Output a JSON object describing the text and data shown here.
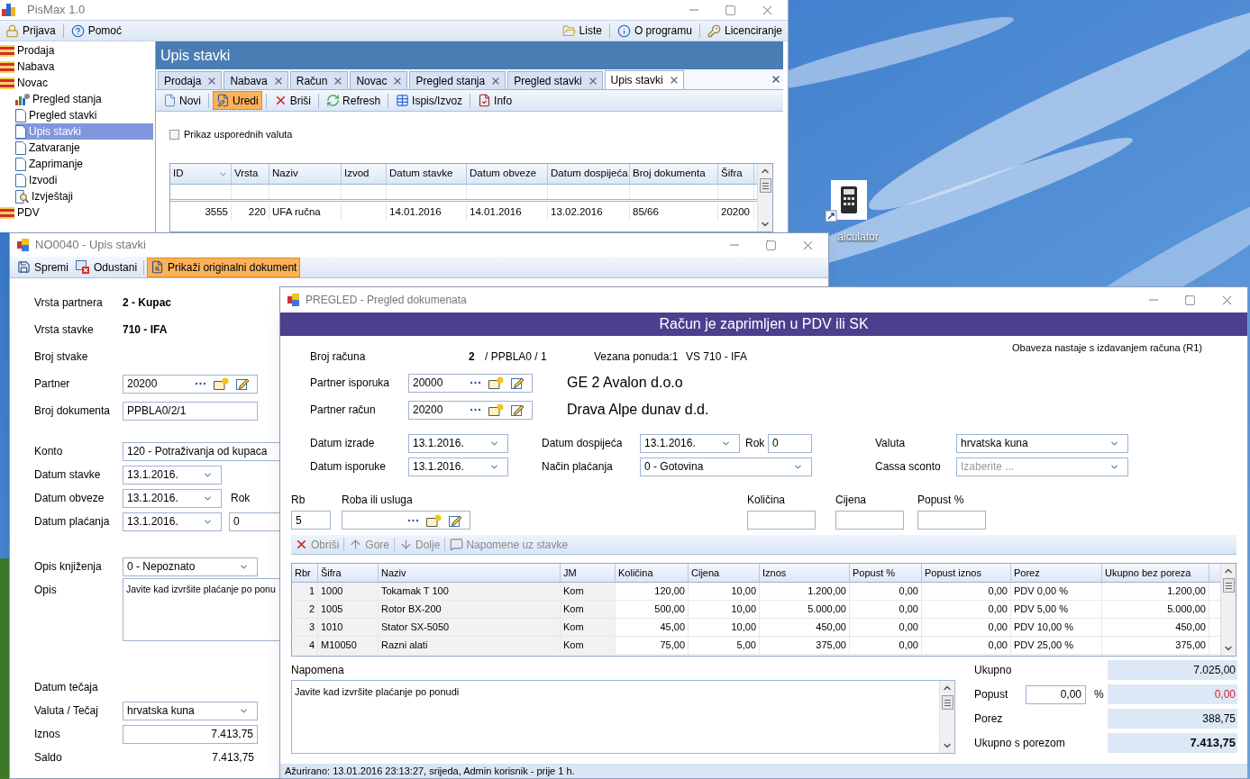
{
  "desktop": {
    "icons": [
      {
        "label": "alculator"
      }
    ]
  },
  "main_window": {
    "title": "PisMax 1.0",
    "menu_left": [
      {
        "label": "Prijava",
        "kind": "lock"
      },
      {
        "label": "Pomoć",
        "kind": "help"
      }
    ],
    "menu_right": [
      {
        "label": "Liste",
        "kind": "folder"
      },
      {
        "label": "O programu",
        "kind": "info"
      },
      {
        "label": "Licenciranje",
        "kind": "key"
      }
    ],
    "tree": [
      {
        "label": "Prodaja",
        "kind": "module",
        "selected": false
      },
      {
        "label": "Nabava",
        "kind": "module",
        "selected": false
      },
      {
        "label": "Novac",
        "kind": "module",
        "selected": false,
        "children": [
          {
            "label": "Pregled stanja",
            "kind": "chart",
            "selected": false
          },
          {
            "label": "Pregled stavki",
            "kind": "page",
            "selected": false
          },
          {
            "label": "Upis stavki",
            "kind": "page",
            "selected": true
          },
          {
            "label": "Zatvaranje",
            "kind": "page",
            "selected": false
          },
          {
            "label": "Zaprimanje",
            "kind": "page",
            "selected": false
          },
          {
            "label": "Izvodi",
            "kind": "page",
            "selected": false
          },
          {
            "label": "Izvještaji",
            "kind": "report",
            "selected": false
          }
        ]
      },
      {
        "label": "PDV",
        "kind": "module",
        "selected": false
      }
    ],
    "panel_title": "Upis stavki",
    "tabs": [
      {
        "label": "Prodaja",
        "selected": false
      },
      {
        "label": "Nabava",
        "selected": false
      },
      {
        "label": "Račun",
        "selected": false
      },
      {
        "label": "Novac",
        "selected": false
      },
      {
        "label": "Pregled stanja",
        "selected": false
      },
      {
        "label": "Pregled stavki",
        "selected": false
      },
      {
        "label": "Upis stavki",
        "selected": true
      }
    ],
    "toolbar": [
      {
        "label": "Novi",
        "kind": "new",
        "selected": false
      },
      {
        "label": "Uredi",
        "kind": "edit",
        "selected": true
      },
      {
        "label": "Briši",
        "kind": "delete",
        "selected": false
      },
      {
        "label": "Refresh",
        "kind": "refresh",
        "selected": false
      },
      {
        "label": "Ispis/Izvoz",
        "kind": "table",
        "selected": false
      },
      {
        "label": "Info",
        "kind": "info",
        "selected": false
      }
    ],
    "checkbox": {
      "label": "Prikaz usporednih valuta",
      "checked": false
    },
    "grid": {
      "columns": [
        "ID",
        "Vrsta",
        "Naziv",
        "Izvod",
        "Datum stavke",
        "Datum obveze",
        "Datum dospijeća",
        "Broj dokumenta",
        "Šifra"
      ],
      "rows": [
        {
          "cells": [
            "3555",
            "220",
            "UFA ručna",
            null,
            "14.01.2016",
            "14.01.2016",
            "13.02.2016",
            "85/66",
            "20200"
          ]
        }
      ]
    }
  },
  "entry_window": {
    "title": "NO0040 - Upis stavki",
    "toolbar": [
      {
        "label": "Spremi",
        "kind": "save",
        "selected": false
      },
      {
        "label": "Odustani",
        "kind": "cancel",
        "selected": false
      },
      {
        "label": "Prikaži originalni dokument",
        "kind": "document",
        "selected": true
      }
    ],
    "groups": [
      [
        {
          "label": "Vrsta partnera",
          "kind": "static",
          "value": "2 - Kupac"
        },
        {
          "label": "Vrsta stavke",
          "kind": "static",
          "value": "710 - IFA"
        },
        {
          "label": "Broj stvake",
          "kind": "label"
        },
        {
          "label": "Partner",
          "kind": "lookup",
          "value": "20200"
        },
        {
          "label": "Broj dokumenta",
          "kind": "text",
          "value": "PPBLA0/2/1"
        }
      ],
      [
        {
          "label": "Konto",
          "kind": "wide",
          "value": "120 - Potraživanja od kupaca"
        },
        {
          "label": "Datum stavke",
          "kind": "date",
          "value": "13.1.2016."
        },
        {
          "label": "Datum obveze",
          "kind": "date",
          "value": "13.1.2016.",
          "extra": {
            "kind": "label",
            "text": "Rok"
          }
        },
        {
          "label": "Datum plaćanja",
          "kind": "date",
          "value": "13.1.2016.",
          "extra": {
            "kind": "field",
            "text": "0"
          }
        }
      ],
      [
        {
          "label": "Opis knjiženja",
          "kind": "dropdown",
          "value": "0 - Nepoznato"
        },
        {
          "label": "Opis",
          "kind": "memo",
          "value": "Javite kad izvršite plaćanje po ponu"
        }
      ],
      [
        {
          "label": "Datum tečaja",
          "kind": "label"
        },
        {
          "label": "Valuta / Tečaj",
          "kind": "dropdown",
          "value": "hrvatska kuna"
        },
        {
          "label": "Iznos",
          "kind": "amount",
          "value": "7.413,75"
        },
        {
          "label": "Saldo",
          "kind": "readout",
          "value": "7.413,75"
        }
      ]
    ]
  },
  "preview_window": {
    "title": "PREGLED - Pregled dokumenata",
    "banner": "Račun je zaprimljen u PDV ili SK",
    "invoice": {
      "label": "Broj računa",
      "number": "2",
      "suffix": "/ PPBLA0 / 1",
      "linked_offer": "Vezana ponuda:1",
      "document_type": "VS 710 - IFA",
      "obligation_note": "Obaveza nastaje s izdavanjem računa (R1)"
    },
    "partners": [
      {
        "label": "Partner isporuka",
        "value": "20000",
        "name": "GE 2 Avalon d.o.o"
      },
      {
        "label": "Partner račun",
        "value": "20200",
        "name": "Drava Alpe dunav d.d."
      }
    ],
    "datum_izrade": {
      "label": "Datum izrade",
      "value": "13.1.2016."
    },
    "datum_isporuke": {
      "label": "Datum isporuke",
      "value": "13.1.2016."
    },
    "datum_dospijeca": {
      "label": "Datum dospijeća",
      "value": "13.1.2016."
    },
    "rok": {
      "label": "Rok",
      "value": "0"
    },
    "nacin_placanja": {
      "label": "Način plaćanja",
      "value": "0 - Gotovina"
    },
    "valuta": {
      "label": "Valuta",
      "value": "hrvatska kuna"
    },
    "cassa_sconto": {
      "label": "Cassa sconto",
      "placeholder": "Izaberite ..."
    },
    "item_entry": {
      "rb": {
        "label": "Rb",
        "value": "5"
      },
      "item": {
        "label": "Roba ili usluga"
      },
      "quantity": {
        "label": "Količina"
      },
      "price": {
        "label": "Cijena"
      },
      "discount": {
        "label": "Popust %"
      }
    },
    "item_toolbar": [
      {
        "label": "Obriši",
        "kind": "delete",
        "disabled": true
      },
      {
        "label": "Gore",
        "kind": "up",
        "disabled": true
      },
      {
        "label": "Dolje",
        "kind": "down",
        "disabled": true
      },
      {
        "label": "Napomene uz stavke",
        "kind": "note",
        "disabled": true
      }
    ],
    "items_table": {
      "columns": [
        "Rbr",
        "Šifra",
        "Naziv",
        "JM",
        "Količina",
        "Cijena",
        "Iznos",
        "Popust %",
        "Popust iznos",
        "Porez",
        "Ukupno bez poreza"
      ],
      "rows": [
        {
          "cells": [
            "1",
            "1000",
            "Tokamak T 100",
            "Kom",
            "120,00",
            "10,00",
            "1.200,00",
            "0,00",
            "0,00",
            "PDV 0,00 %",
            "1.200,00"
          ]
        },
        {
          "cells": [
            "2",
            "1005",
            "Rotor BX-200",
            "Kom",
            "500,00",
            "10,00",
            "5.000,00",
            "0,00",
            "0,00",
            "PDV 5,00 %",
            "5.000,00"
          ]
        },
        {
          "cells": [
            "3",
            "1010",
            "Stator SX-5050",
            "Kom",
            "45,00",
            "10,00",
            "450,00",
            "0,00",
            "0,00",
            "PDV 10,00 %",
            "450,00"
          ]
        },
        {
          "cells": [
            "4",
            "M10050",
            "Razni alati",
            "Kom",
            "75,00",
            "5,00",
            "375,00",
            "0,00",
            "0,00",
            "PDV 25,00 %",
            "375,00"
          ]
        }
      ]
    },
    "note": {
      "label": "Napomena",
      "value": "Javite kad izvršite plaćanje po ponudi"
    },
    "totals": [
      {
        "label": "Ukupno",
        "kind": "plain",
        "value": "7.025,00"
      },
      {
        "label": "Popust",
        "kind": "discount",
        "input": "0,00",
        "unit": "%",
        "value": "0,00"
      },
      {
        "label": "Porez",
        "kind": "plain",
        "value": "388,75"
      },
      {
        "label": "Ukupno s porezom",
        "kind": "bold",
        "value": "7.413,75"
      }
    ],
    "status": "Ažurirano: 13.01.2016 23:13:27, srijeda, Admin korisnik -  prije 1 h."
  }
}
